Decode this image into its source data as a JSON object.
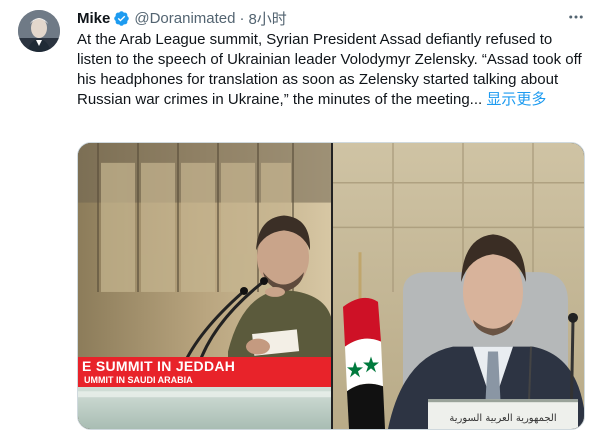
{
  "tweet": {
    "author": {
      "display_name": "Mike",
      "handle": "@Doranimated",
      "verified": true,
      "verified_color": "#1d9bf0"
    },
    "separator": "·",
    "timestamp": "8小时",
    "more_icon": "more-horizontal-icon",
    "text": "At the Arab League summit, Syrian President Assad defiantly refused to listen to the speech of Ukrainian leader Volodymyr Zelensky.  “Assad took off his headphones for translation as soon as Zelensky started talking about Russian war crimes in Ukraine,” the minutes of the meeting...",
    "show_more_label": "显示更多",
    "link_color": "#1d9bf0"
  },
  "media": {
    "banner": {
      "title": "E SUMMIT IN JEDDAH",
      "subtitle": "UMMIT IN SAUDI ARABIA",
      "color": "#e8232a"
    },
    "nameplate_text": "الجمهورية العربية السورية"
  }
}
